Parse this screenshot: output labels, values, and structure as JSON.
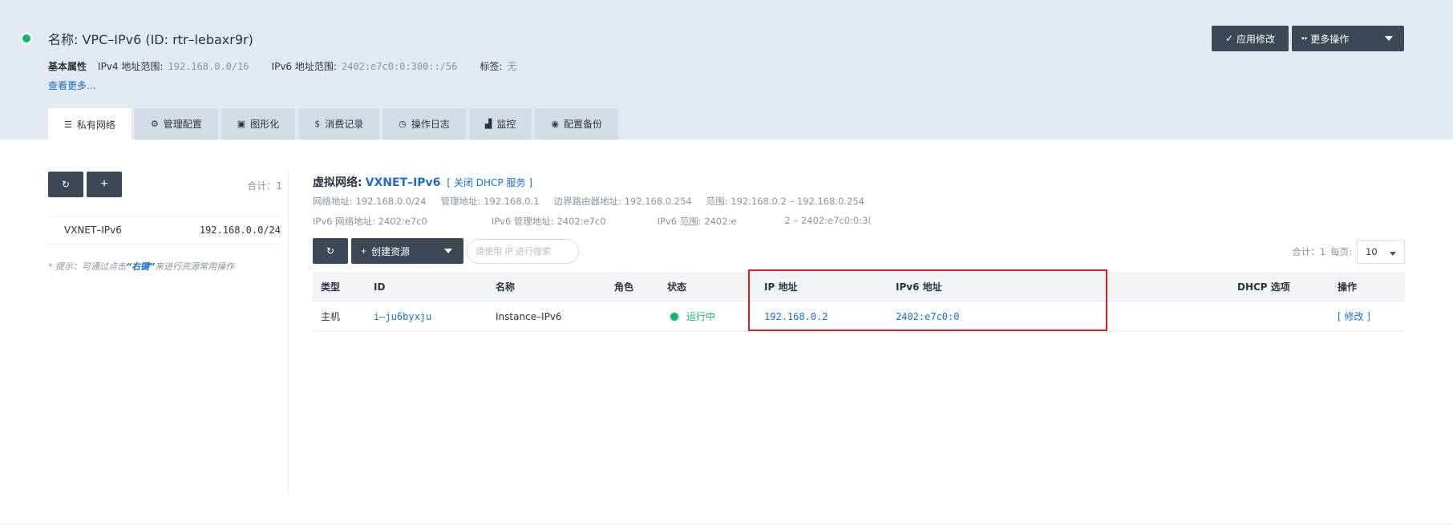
{
  "header": {
    "title": "名称: VPC–IPv6 (ID: rtr–lebaxr9r)",
    "props_label": "基本属性",
    "ipv4_label": "IPv4 地址范围:",
    "ipv4_value": "192.168.0.0/16",
    "ipv6_label": "IPv6 地址范围:",
    "ipv6_value": "2402:e7c0:0:300::/56",
    "tag_label": "标签:",
    "tag_value": "无",
    "more_link": "查看更多...",
    "apply_label": "应用修改",
    "more_ops_label": "更多操作",
    "status_color": "#17b26a"
  },
  "tabs": [
    {
      "icon": "list-icon",
      "glyph": "☰",
      "label": "私有网络",
      "active": true
    },
    {
      "icon": "gears-icon",
      "glyph": "⚙",
      "label": "管理配置",
      "active": false
    },
    {
      "icon": "image-icon",
      "glyph": "▣",
      "label": "图形化",
      "active": false
    },
    {
      "icon": "dollar-icon",
      "glyph": "$",
      "label": "消费记录",
      "active": false
    },
    {
      "icon": "clock-icon",
      "glyph": "◷",
      "label": "操作日志",
      "active": false
    },
    {
      "icon": "area-chart-icon",
      "glyph": "▟",
      "label": "监控",
      "active": false
    },
    {
      "icon": "camera-icon",
      "glyph": "◉",
      "label": "配置备份",
      "active": false
    }
  ],
  "left": {
    "count": "合计：1",
    "add_label": "+",
    "vxnet_name": "VXNET–IPv6",
    "vxnet_cidr": "192.168.0.0/24",
    "hint_prefix": "* 提示：可通过点击",
    "hint_key": "“右键”",
    "hint_suffix": "来进行资源常用操作"
  },
  "main": {
    "vxnet_title": "虚拟网络:",
    "vxnet_name": "VXNET–IPv6",
    "dhcp_link": "[ 关闭 DHCP 服务 ]",
    "info1": [
      "网络地址: 192.168.0.0/24",
      "管理地址: 192.168.0.1",
      "边界路由器地址: 192.168.0.254",
      "范围: 192.168.0.2 – 192.168.0.254"
    ],
    "info2": [
      "IPv6 网络地址: 2402:e7c0",
      "IPv6 管理地址: 2402:e7c0",
      "IPv6 范围: 2402:e",
      "2 – 2402:e7c0:0:3("
    ],
    "create_label": "创建资源",
    "search_placeholder": "请使用 IP 进行搜索",
    "pager_count": "合计：1",
    "pager_per_page": "每页:",
    "pager_size": "10"
  },
  "table": {
    "headers": {
      "type": "类型",
      "id": "ID",
      "name": "名称",
      "role": "角色",
      "status": "状态",
      "ip": "IP 地址",
      "ipv6": "IPv6 地址",
      "dhcp": "DHCP 选项",
      "op": "操作"
    },
    "rows": [
      {
        "type": "主机",
        "id": "i–ju6byxju",
        "name": "Instance–IPv6",
        "role": "",
        "status": "运行中",
        "ip": "192.168.0.2",
        "ipv6": "2402:e7c0:0",
        "dhcp": "",
        "op": "[ 修改 ]"
      }
    ]
  },
  "colors": {
    "header_bg": "#e3e9f0",
    "button_dark": "#3c4856",
    "link_blue": "#1d6fc4",
    "running_green": "#17b26a",
    "highlight_red": "#d92020"
  }
}
